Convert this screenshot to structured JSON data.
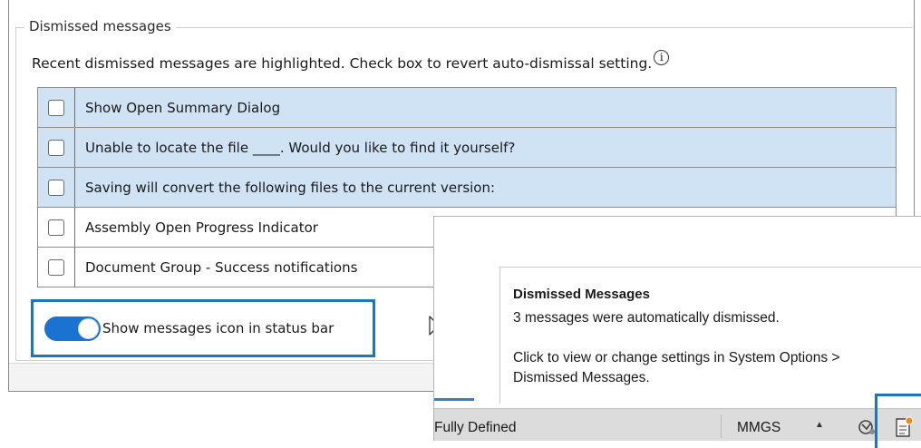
{
  "settings_panel": {
    "group_title": "Dismissed messages",
    "description": "Recent dismissed messages are highlighted. Check box to revert auto-dismissal setting.",
    "info_glyph": "i",
    "messages": [
      {
        "label": "Show Open Summary Dialog",
        "highlighted": true,
        "checked": false
      },
      {
        "label": "Unable to locate the file ____.  Would you like to find it yourself?",
        "highlighted": true,
        "checked": false
      },
      {
        "label": "Saving will convert the following files to the current version:",
        "highlighted": true,
        "checked": false
      },
      {
        "label": "Assembly Open Progress Indicator",
        "highlighted": false,
        "checked": false
      },
      {
        "label": "Document Group - Success notifications",
        "highlighted": false,
        "checked": false
      }
    ],
    "toggle": {
      "label": "Show messages icon in status bar",
      "on": true
    }
  },
  "tooltip": {
    "title": "Dismissed Messages",
    "line1": "3 messages were automatically dismissed.",
    "line2": "Click to view or change settings in System Options >",
    "line3": "Dismissed Messages."
  },
  "status_bar": {
    "state": "Fully Defined",
    "units": "MMGS",
    "units_arrow": "▲"
  },
  "colors": {
    "accent": "#1f75b5",
    "row_highlight": "#cfe3f5",
    "toggle_on": "#1a73d0",
    "notification_dot": "#f08a1c"
  },
  "icons": [
    "info-icon",
    "checkbox-icon",
    "cursor-arrow-icon",
    "rebuild-icon",
    "dismissed-messages-icon"
  ]
}
